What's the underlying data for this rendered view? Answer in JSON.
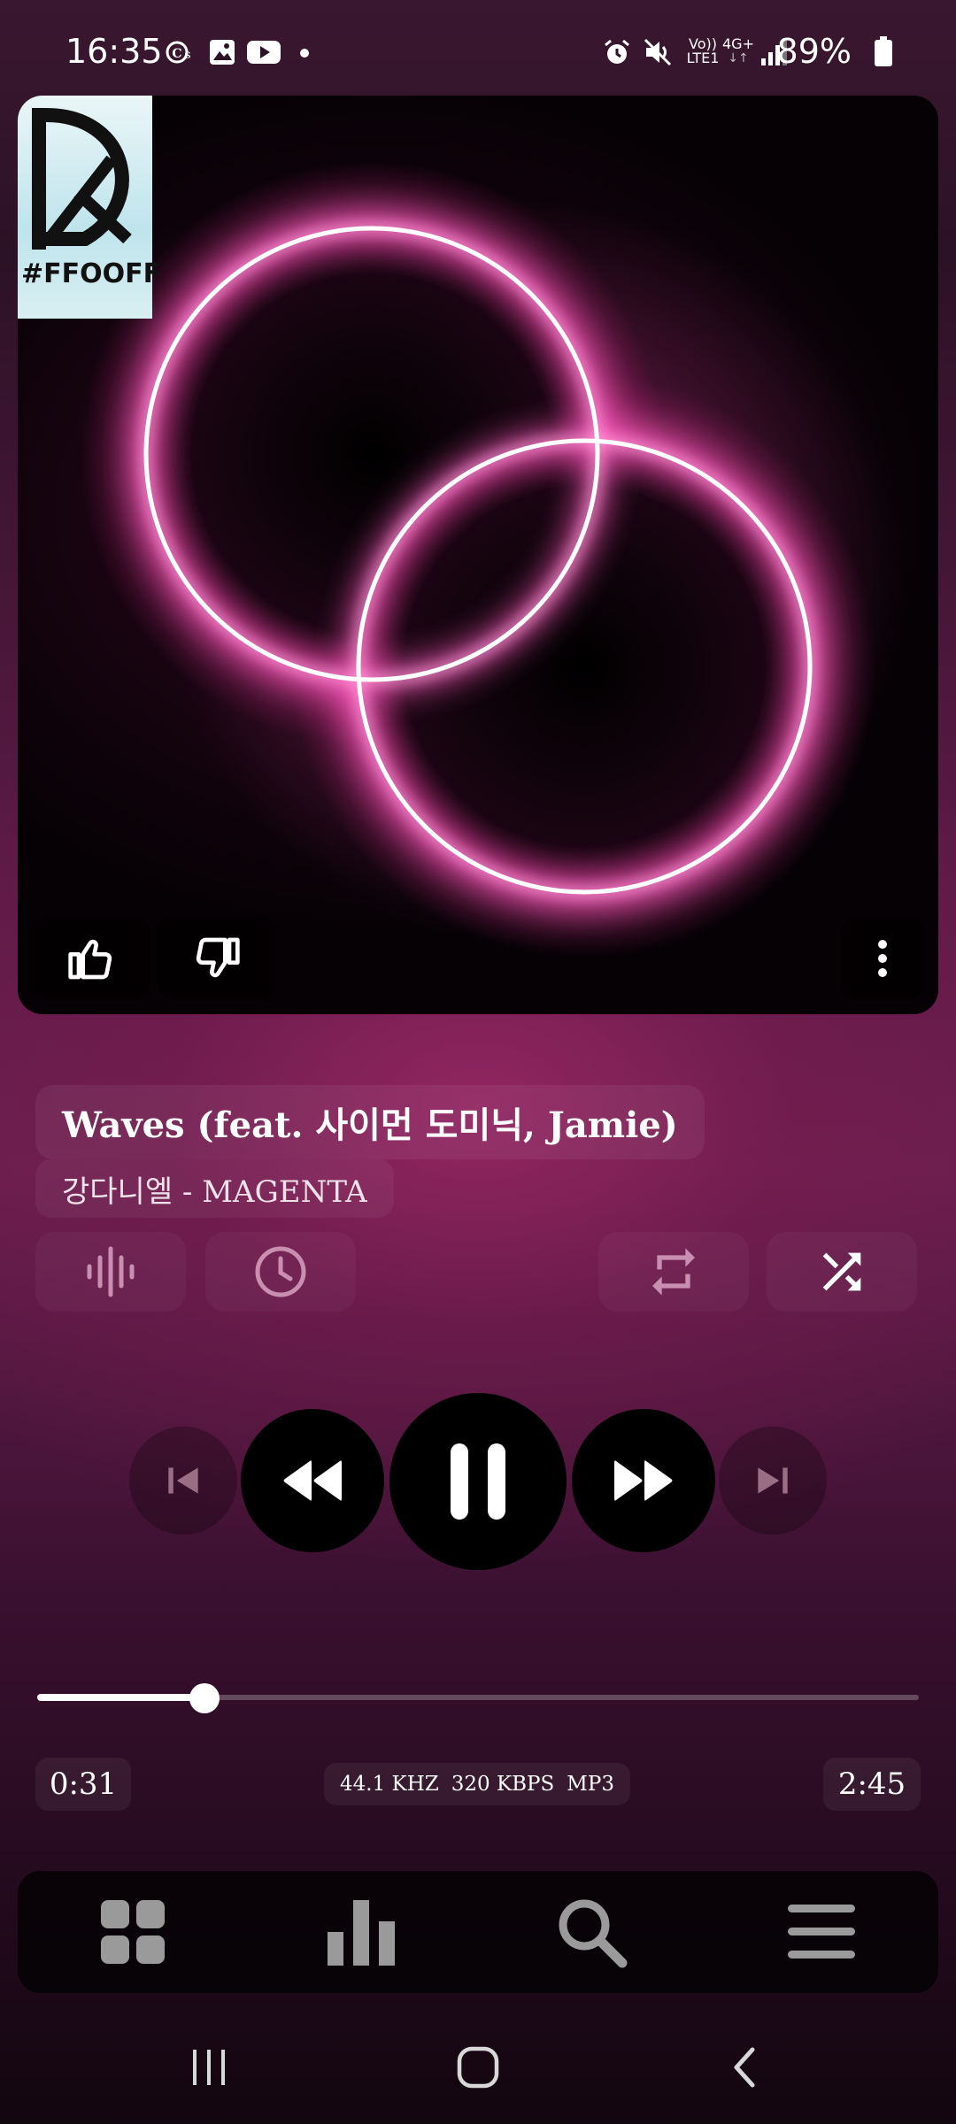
{
  "status_bar": {
    "time": "16:35",
    "network_top": "Vo))",
    "network_bottom": "LTE1",
    "network_type": "4G+",
    "battery_percent": "89%"
  },
  "album_art": {
    "logo_text": "#FFOOFF",
    "colors": {
      "glow": "#e0409a",
      "ring": "#ffffff",
      "background": "#050104"
    }
  },
  "track": {
    "title": "Waves (feat. 사이먼 도미닉, Jamie)",
    "artist_album": "강다니엘 - MAGENTA"
  },
  "playback": {
    "elapsed": "0:31",
    "duration": "2:45",
    "progress_fraction": 0.19,
    "sample_rate": "44.1 KHZ",
    "bitrate": "320 KBPS",
    "format": "MP3"
  },
  "icons": {
    "art_actions": [
      "thumbs-up-icon",
      "thumbs-down-icon",
      "more-vert-icon"
    ],
    "tools": [
      "waveform-icon",
      "timer-icon",
      "repeat-icon",
      "shuffle-icon"
    ],
    "transport": [
      "skip-previous-icon",
      "rewind-icon",
      "pause-icon",
      "fast-forward-icon",
      "skip-next-icon"
    ],
    "bottom_nav": [
      "grid-icon",
      "chart-icon",
      "search-icon",
      "menu-icon"
    ],
    "system_nav": [
      "recent-apps-icon",
      "home-icon",
      "back-icon"
    ]
  },
  "theme": {
    "accent": "#8e2a66",
    "text": "#ffffff"
  }
}
